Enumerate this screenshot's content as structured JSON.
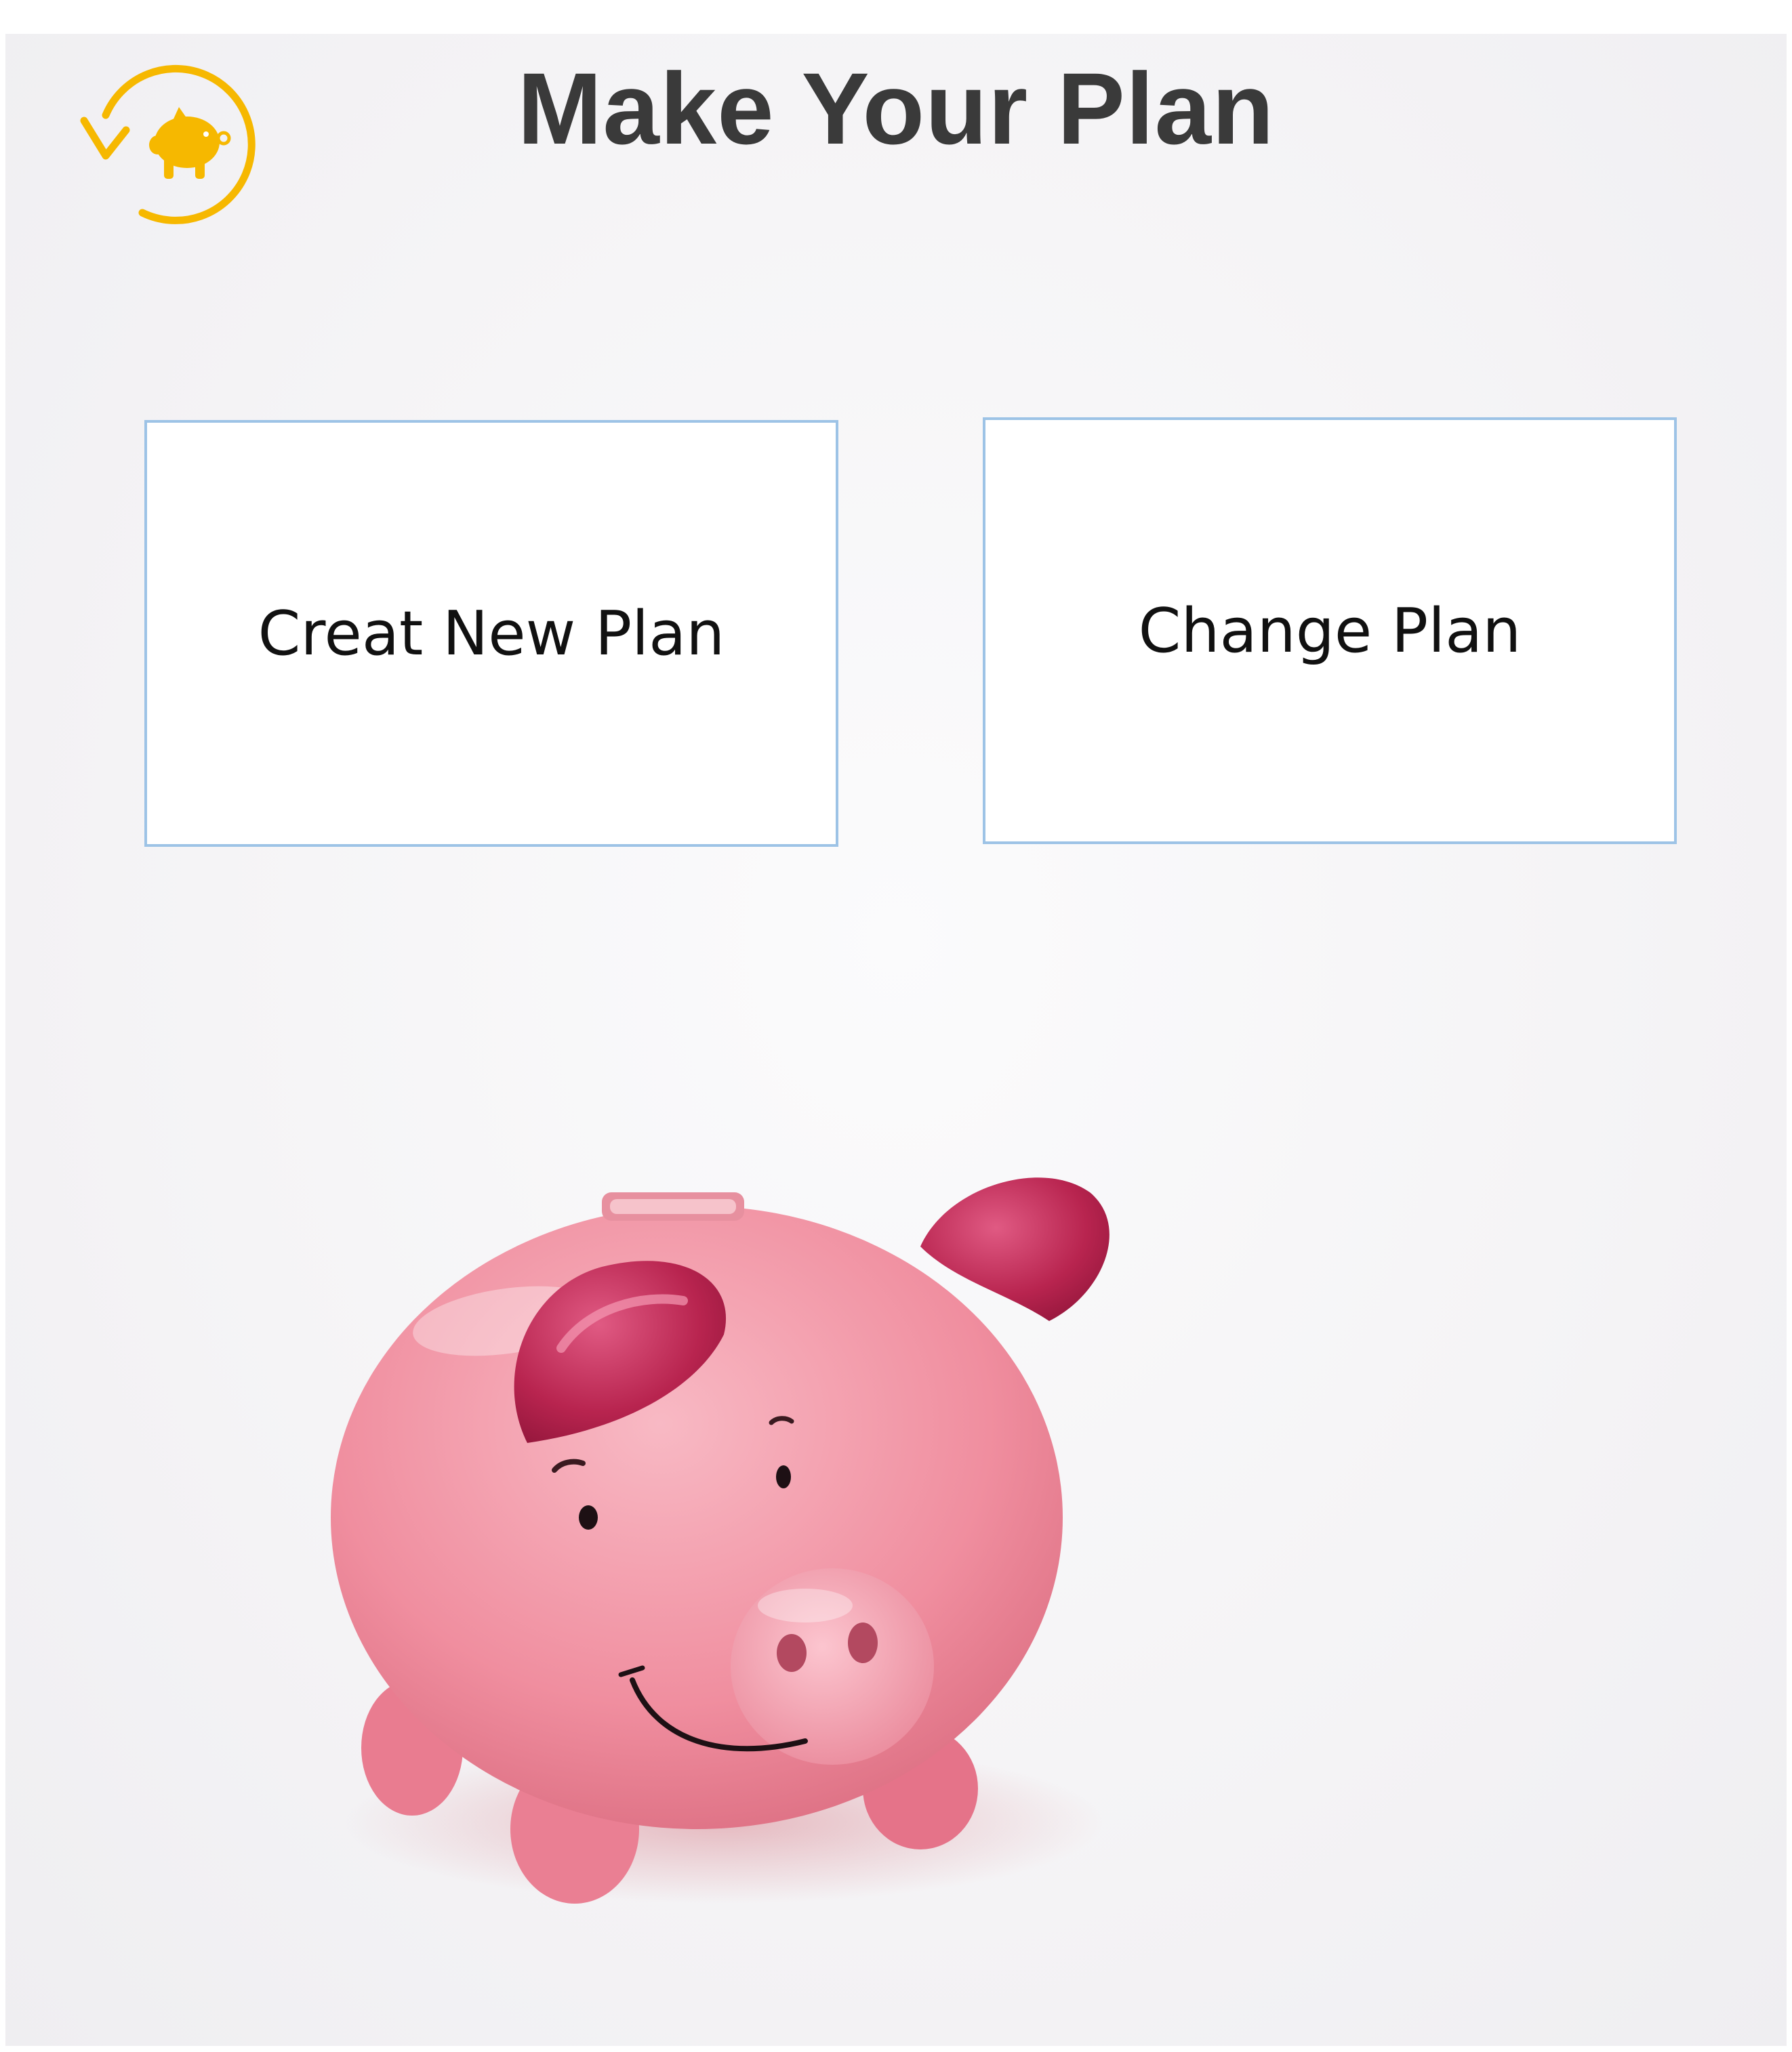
{
  "header": {
    "title": "Make Your Plan",
    "back_icon": "piggy-bank-back-icon",
    "accent_color": "#f6b800"
  },
  "actions": {
    "create_label": "Creat New Plan",
    "change_label": "Change Plan",
    "border_color": "#9dc3e6"
  },
  "hero": {
    "image": "pink-piggy-bank-illustration"
  }
}
